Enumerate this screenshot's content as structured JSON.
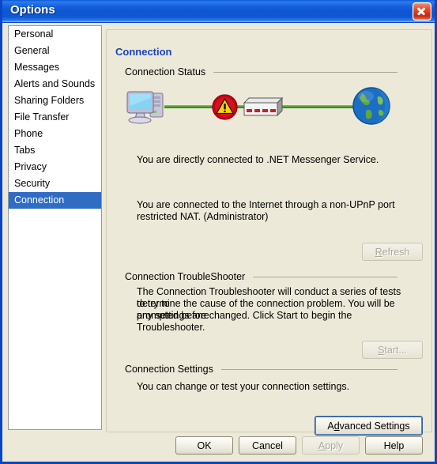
{
  "window": {
    "title": "Options",
    "close_icon": "close-icon"
  },
  "sidebar": {
    "items": [
      {
        "label": "Personal",
        "selected": false
      },
      {
        "label": "General",
        "selected": false
      },
      {
        "label": "Messages",
        "selected": false
      },
      {
        "label": "Alerts and Sounds",
        "selected": false
      },
      {
        "label": "Sharing Folders",
        "selected": false
      },
      {
        "label": "File Transfer",
        "selected": false
      },
      {
        "label": "Phone",
        "selected": false
      },
      {
        "label": "Tabs",
        "selected": false
      },
      {
        "label": "Privacy",
        "selected": false
      },
      {
        "label": "Security",
        "selected": false
      },
      {
        "label": "Connection",
        "selected": true
      }
    ]
  },
  "panel": {
    "group_title": "Connection",
    "status_section": {
      "heading": "Connection Status",
      "diagram": {
        "nodes": [
          "computer-icon",
          "warning-icon",
          "router-icon",
          "globe-icon"
        ],
        "link_color": "#4E9A28",
        "warning_color": "#CC0011"
      },
      "line1": "You are directly connected to .NET Messenger Service.",
      "line2": "You are connected to the Internet through a non-UPnP port",
      "line3": "restricted NAT.  (Administrator)",
      "refresh_button": {
        "prefix": "",
        "accel": "R",
        "suffix": "efresh",
        "disabled": true
      }
    },
    "troubleshooter_section": {
      "heading": "Connection TroubleShooter",
      "line1": "The Connection Troubleshooter will conduct a series of tests to try to",
      "line2": "determine the cause of the connection problem. You will be prompted before",
      "line3": "any settings are changed. Click Start to begin the Troubleshooter.",
      "start_button": {
        "prefix": "",
        "accel": "S",
        "suffix": "tart...",
        "disabled": true
      }
    },
    "settings_section": {
      "heading": "Connection Settings",
      "line1": "You can change or test your connection settings.",
      "advanced_button": {
        "prefix": "A",
        "accel": "d",
        "suffix": "vanced Settings",
        "disabled": false
      }
    }
  },
  "footer": {
    "ok": {
      "label": "OK",
      "disabled": false
    },
    "cancel": {
      "label": "Cancel",
      "disabled": false
    },
    "apply": {
      "prefix": "",
      "accel": "A",
      "suffix": "pply",
      "disabled": true
    },
    "help": {
      "label": "Help",
      "disabled": false
    }
  },
  "colors": {
    "titlebar_blue": "#0E56D2",
    "window_border": "#0A45C8",
    "panel_bg": "#ECE9D8",
    "selection_blue": "#2F6CC4",
    "group_title_blue": "#1A43BE",
    "close_red": "#C32B10"
  }
}
